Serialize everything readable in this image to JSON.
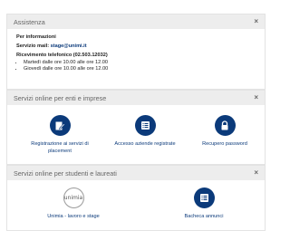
{
  "assistenza": {
    "title": "Assistenza",
    "info_heading": "Per informazioni",
    "mail_label": "Servizio mail:",
    "mail_value": "stage@unimi.it",
    "phone_label": "Ricevimento telefonico (02.503.12032)",
    "hours": [
      "Martedì dalle ore 10.00 alle ore 12.00",
      "Giovedì dalle ore 10.00 alle ore 12.00"
    ]
  },
  "enti": {
    "title": "Servizi online per enti e imprese",
    "items": [
      {
        "label_line1": "Registrazione ai servizi di",
        "label_line2": "placement",
        "icon": "edit-icon"
      },
      {
        "label_line1": "Accesso aziende registrate",
        "label_line2": "",
        "icon": "list-icon"
      },
      {
        "label_line1": "Recupero password",
        "label_line2": "",
        "icon": "lock-icon"
      }
    ]
  },
  "studenti": {
    "title": "Servizi online per studenti e laureati",
    "items": [
      {
        "label": "Unimia - lavoro e stage",
        "logo_text": "unimia"
      },
      {
        "label": "Bacheca annunci",
        "icon": "list-icon"
      }
    ]
  },
  "close_symbol": "×",
  "colors": {
    "accent": "#0b3a7a",
    "header_bg": "#ededed"
  }
}
